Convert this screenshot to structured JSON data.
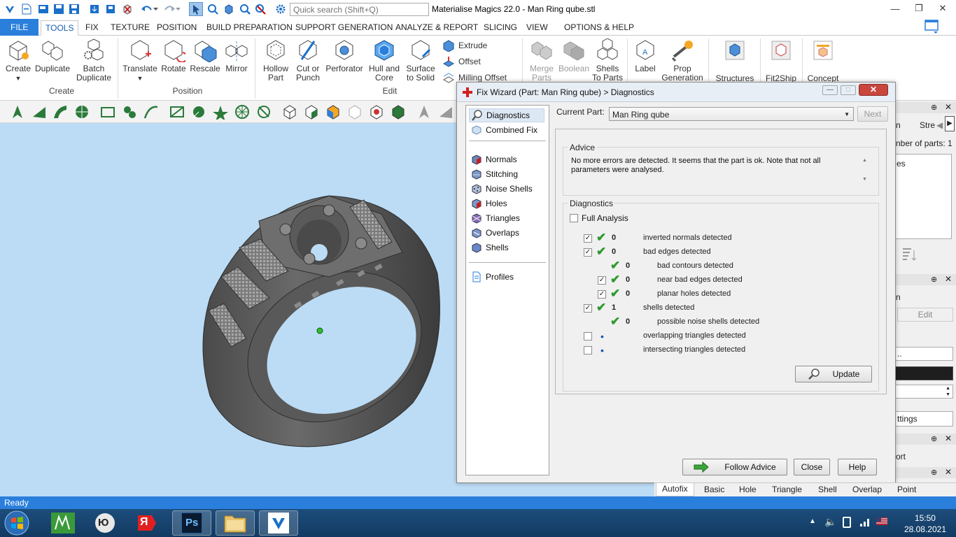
{
  "app": {
    "title": "Materialise Magics 22.0 - Man Ring qube.stl",
    "search_placeholder": "Quick search (Shift+Q)"
  },
  "ribbon_tabs": [
    "FILE",
    "TOOLS",
    "FIX",
    "TEXTURE",
    "POSITION",
    "BUILD PREPARATION",
    "SUPPORT GENERATION",
    "ANALYZE & REPORT",
    "SLICING",
    "VIEW",
    "OPTIONS & HELP"
  ],
  "active_tab": "TOOLS",
  "ribbon": {
    "create_group": "Create",
    "position_group": "Position",
    "edit_group": "Edit",
    "create": "Create",
    "duplicate": "Duplicate",
    "batch_duplicate": [
      "Batch",
      "Duplicate"
    ],
    "translate": "Translate",
    "rotate": "Rotate",
    "rescale": "Rescale",
    "mirror": "Mirror",
    "hollow_part": [
      "Hollow",
      "Part"
    ],
    "cut_or_punch": [
      "Cut or",
      "Punch"
    ],
    "perforator": "Perforator",
    "hull_and_core": [
      "Hull and",
      "Core"
    ],
    "surface_to_solid": [
      "Surface",
      "to Solid"
    ],
    "extrude": "Extrude",
    "offset": "Offset",
    "milling_offset": "Milling Offset",
    "merge_parts": [
      "Merge",
      "Parts"
    ],
    "boolean": "Boolean",
    "shells_to_parts": [
      "Shells",
      "To Parts"
    ],
    "label": "Label",
    "prop_generation": [
      "Prop",
      "Generation"
    ],
    "structures": "Structures",
    "fit2ship": "Fit2Ship",
    "concept": "Concept"
  },
  "dialog": {
    "title": "Fix Wizard (Part: Man Ring qube) > Diagnostics",
    "current_part_label": "Current Part:",
    "current_part_value": "Man Ring qube",
    "next_button": "Next",
    "nav": {
      "diagnostics": "Diagnostics",
      "combined_fix": "Combined Fix",
      "normals": "Normals",
      "stitching": "Stitching",
      "noise_shells": "Noise Shells",
      "holes": "Holes",
      "triangles": "Triangles",
      "overlaps": "Overlaps",
      "shells": "Shells",
      "profiles": "Profiles"
    },
    "advice_title": "Advice",
    "advice_text": "No more errors are detected. It seems that the part is ok. Note that not all parameters were analysed.",
    "diagnostics_title": "Diagnostics",
    "full_analysis": "Full Analysis",
    "rows": [
      {
        "checkbox": true,
        "checked": true,
        "status": "ok",
        "count": "0",
        "label": "inverted normals detected",
        "indent": 0
      },
      {
        "checkbox": true,
        "checked": true,
        "status": "ok",
        "count": "0",
        "label": "bad edges detected",
        "indent": 0
      },
      {
        "checkbox": false,
        "checked": false,
        "status": "ok",
        "count": "0",
        "label": "bad contours detected",
        "indent": 1
      },
      {
        "checkbox": true,
        "checked": true,
        "status": "ok",
        "count": "0",
        "label": "near bad edges detected",
        "indent": 1
      },
      {
        "checkbox": true,
        "checked": true,
        "status": "ok",
        "count": "0",
        "label": "planar holes detected",
        "indent": 1
      },
      {
        "checkbox": true,
        "checked": true,
        "status": "ok",
        "count": "1",
        "label": "shells detected",
        "indent": 0
      },
      {
        "checkbox": false,
        "checked": false,
        "status": "ok",
        "count": "0",
        "label": "possible noise shells detected",
        "indent": 1
      },
      {
        "checkbox": true,
        "checked": false,
        "status": "dot",
        "count": "",
        "label": "overlapping triangles detected",
        "indent": 0
      },
      {
        "checkbox": true,
        "checked": false,
        "status": "dot",
        "count": "",
        "label": "intersecting triangles detected",
        "indent": 0
      }
    ],
    "update_button": "Update",
    "follow_advice_button": "Follow Advice",
    "close_button": "Close",
    "help_button": "Help"
  },
  "right_panel": {
    "n_label": "n",
    "stre_label": "Stre",
    "parts_label": "nber of parts: 1",
    "es_label": "es",
    "n2_label": "n",
    "edit_label": "Edit",
    "dots_label": "..",
    "ttings_label": "ttings",
    "ort_label": "ort"
  },
  "bottom_tabs": [
    "Autofix",
    "Basic",
    "Hole",
    "Triangle",
    "Shell",
    "Overlap",
    "Point"
  ],
  "status_text": "Ready",
  "taskbar": {
    "time": "15:50",
    "date": "28.08.2021",
    "app_yu": "Ю",
    "app_ya": "Я",
    "app_ps": "Ps"
  },
  "colors": {
    "accent": "#2a7fdc",
    "viewport": "#bcdcf5",
    "ok_tick": "#2d9a2d"
  }
}
